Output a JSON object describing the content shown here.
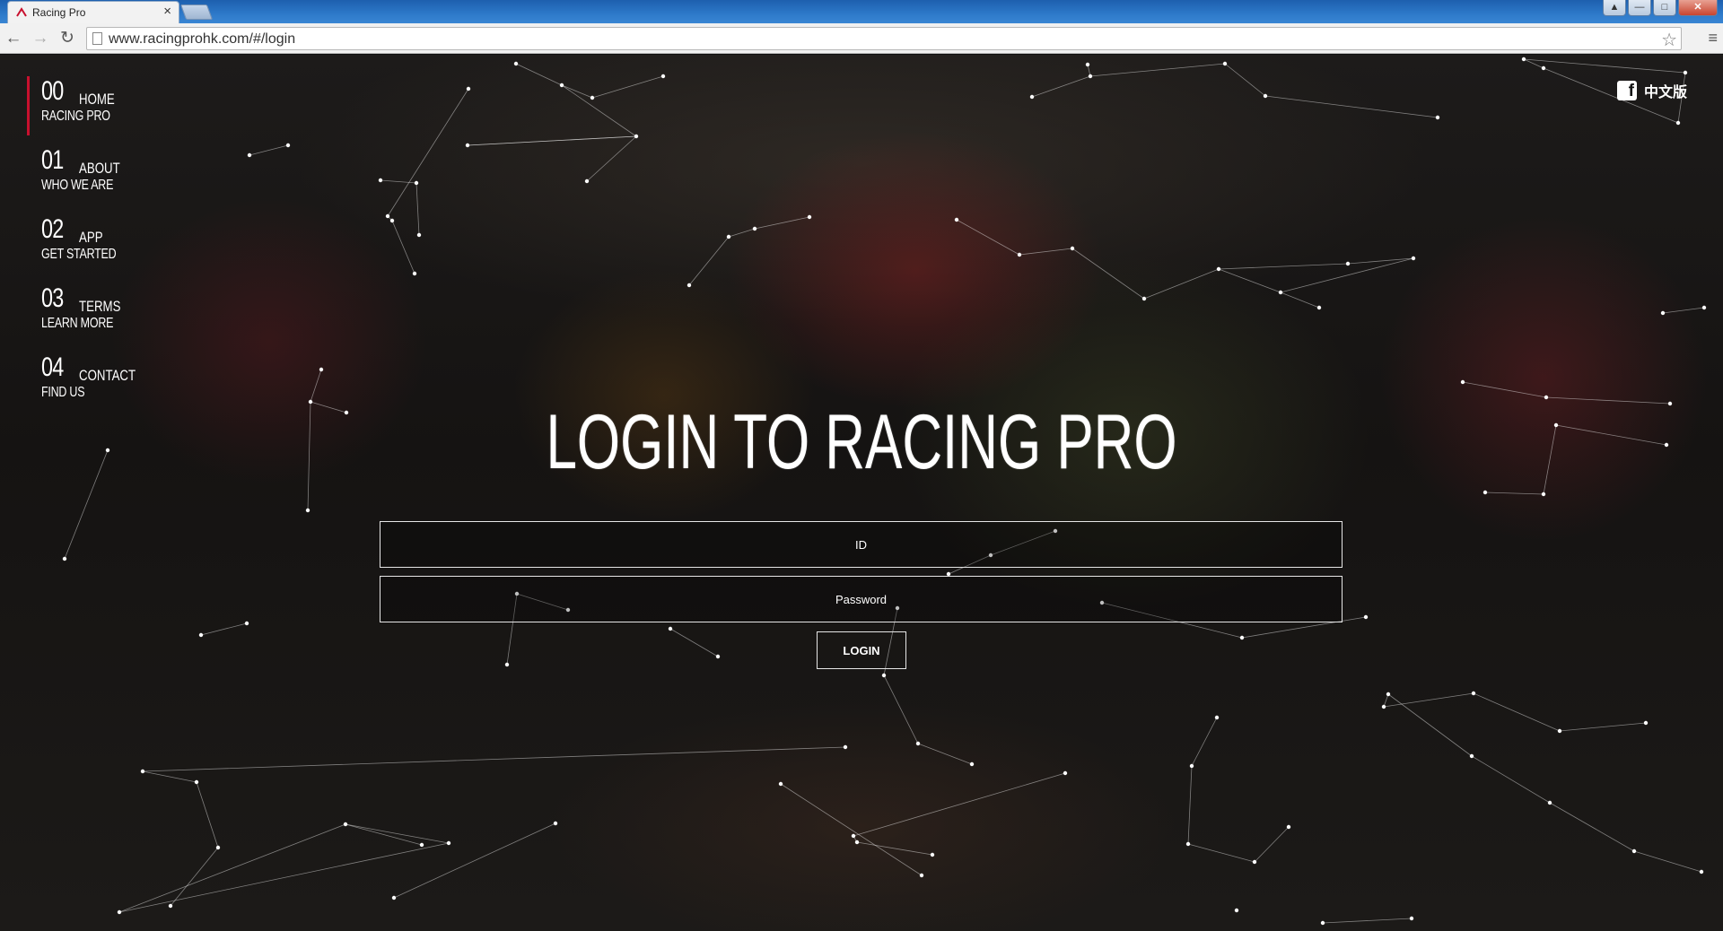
{
  "browser": {
    "tab_title": "Racing Pro",
    "url": "www.racingprohk.com/#/login",
    "window_controls": [
      "minimize-icon",
      "maximize-icon",
      "close-icon"
    ]
  },
  "nav": {
    "items": [
      {
        "num": "00",
        "label": "HOME",
        "sub": "RACING PRO",
        "active": true
      },
      {
        "num": "01",
        "label": "ABOUT",
        "sub": "WHO WE ARE",
        "active": false
      },
      {
        "num": "02",
        "label": "APP",
        "sub": "GET STARTED",
        "active": false
      },
      {
        "num": "03",
        "label": "TERMS",
        "sub": "LEARN MORE",
        "active": false
      },
      {
        "num": "04",
        "label": "CONTACT",
        "sub": "FIND US",
        "active": false
      }
    ]
  },
  "lang_link": {
    "icon": "facebook-icon",
    "label": "中文版"
  },
  "login": {
    "title": "LOGIN TO RACING PRO",
    "id_placeholder": "ID",
    "password_placeholder": "Password",
    "button_label": "LOGIN"
  },
  "colors": {
    "accent": "#c8102e",
    "text": "#ffffff",
    "background": "#141312"
  }
}
